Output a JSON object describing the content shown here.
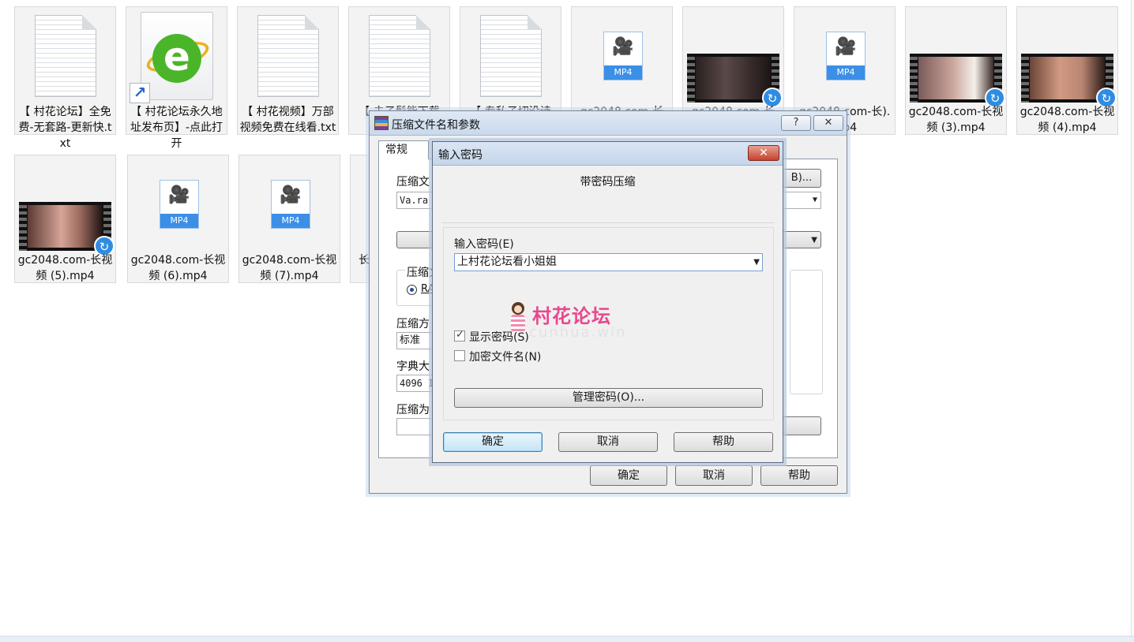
{
  "files": [
    {
      "label": "【 村花论坛】全免费-无套路-更新快.txt",
      "icon": "text-file-icon"
    },
    {
      "label": "【 村花论坛永久地址发布页】-点此打开",
      "icon": "ie-shortcut-icon"
    },
    {
      "label": "【 村花视频】万部视频免费在线看.txt",
      "icon": "text-file-icon"
    },
    {
      "label": "【 夫子髡能下载",
      "icon": "text-file-icon"
    },
    {
      "label": "【 专私子切没诗",
      "icon": "text-file-icon"
    },
    {
      "label": "gc2048.com-长",
      "icon": "mp4-file-icon"
    },
    {
      "label": "gc2048.com-长",
      "icon": "video-thumbnail-icon"
    },
    {
      "label": "gc2048.com-长).mp4",
      "icon": "mp4-file-icon"
    },
    {
      "label": "gc2048.com-长视频 (3).mp4",
      "icon": "video-thumbnail-icon"
    },
    {
      "label": "gc2048.com-长视频 (4).mp4",
      "icon": "video-thumbnail-icon"
    },
    {
      "label": "gc2048.com-长视频 (5).mp4",
      "icon": "video-thumbnail-icon"
    },
    {
      "label": "gc2048.com-长视频 (6).mp4",
      "icon": "mp4-file-icon"
    },
    {
      "label": "gc2048.com-长视频 (7).mp4",
      "icon": "mp4-file-icon"
    },
    {
      "label": "长",
      "icon": "mp4-file-icon"
    }
  ],
  "mp4_badge": "MP4",
  "rar_window": {
    "title": "压缩文件名和参数",
    "help_btn": "?",
    "close_btn": "✕",
    "tab_general": "常规",
    "archive_name_label": "压缩文",
    "archive_name_value": "Va.ra",
    "browse_btn": "B)...",
    "archive_format_label": "压缩文",
    "format_rar": "RA",
    "method_label": "压缩方",
    "method_value": "标准",
    "dict_label": "字典大",
    "dict_value": "4096 I",
    "split_label": "压缩为",
    "ok": "确定",
    "cancel": "取消",
    "help": "帮助"
  },
  "password_dialog": {
    "title": "输入密码",
    "close": "✕",
    "subtitle": "带密码压缩",
    "field_label": "输入密码(E)",
    "password_value": "上村花论坛看小姐姐",
    "show_password": "显示密码(S)",
    "show_password_checked": true,
    "encrypt_names": "加密文件名(N)",
    "encrypt_names_checked": false,
    "manage": "管理密码(O)...",
    "ok": "确定",
    "cancel": "取消",
    "help": "帮助"
  },
  "watermark": {
    "brand": "村花论坛",
    "url": "cunhua.win"
  }
}
